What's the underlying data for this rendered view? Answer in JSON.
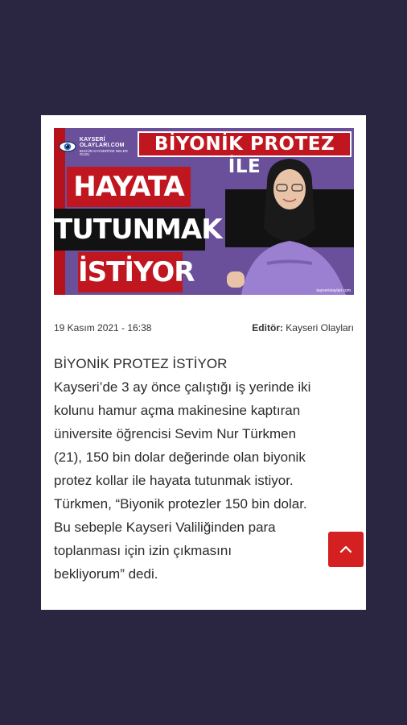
{
  "hero": {
    "logo_line1": "KAYSERİ OLAYLARI.COM",
    "logo_line2": "BUGÜN KAYSERİ'DE NELER OLDU",
    "headline_top": "BİYONİK PROTEZ İLE",
    "headline_1": "HAYATA",
    "headline_2": "TUTUNMAK",
    "headline_3": "İSTİYOR",
    "watermark": "kayserioiaylari.com"
  },
  "meta": {
    "date": "19 Kasım 2021 - 16:38",
    "editor_label": "Editör:",
    "editor_name": "Kayseri Olayları"
  },
  "article": {
    "lines": [
      "BİYONİK PROTEZ İSTİYOR",
      "Kayseri’de 3 ay önce çalıştığı iş yerinde iki",
      "kolunu hamur açma makinesine kaptıran",
      "üniversite öğrencisi Sevim Nur Türkmen",
      "(21), 150 bin dolar değerinde olan biyonik",
      "protez kollar ile hayata tutunmak istiyor.",
      "Türkmen, “Biyonik protezler 150 bin dolar.",
      "Bu sebeple Kayseri Valiliğinden para",
      "toplanması için izin çıkmasını",
      "bekliyorum” dedi."
    ]
  },
  "colors": {
    "page_bg": "#2a2540",
    "hero_purple": "#6a4f9a",
    "headline_red": "#c0161f",
    "button_red": "#d42020"
  },
  "icons": {
    "logo": "eye-icon",
    "scroll": "chevron-up-icon"
  }
}
